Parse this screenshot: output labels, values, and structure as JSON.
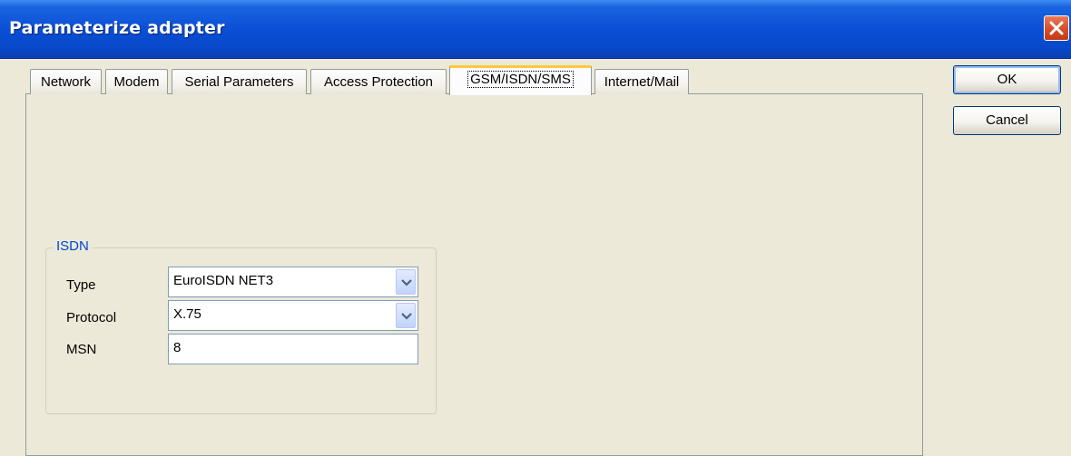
{
  "window": {
    "title": "Parameterize adapter"
  },
  "tabs": [
    {
      "label": "Network"
    },
    {
      "label": "Modem"
    },
    {
      "label": "Serial Parameters"
    },
    {
      "label": "Access Protection"
    },
    {
      "label": "GSM/ISDN/SMS"
    },
    {
      "label": "Internet/Mail"
    }
  ],
  "active_tab": "GSM/ISDN/SMS",
  "isdn": {
    "group_title": "ISDN",
    "type_label": "Type",
    "type_value": "EuroISDN NET3",
    "protocol_label": "Protocol",
    "protocol_value": "X.75",
    "msn_label": "MSN",
    "msn_value": "8"
  },
  "buttons": {
    "ok": "OK",
    "cancel": "Cancel"
  },
  "colors": {
    "titlebar": "#0a4fd6",
    "close_button": "#d8512e",
    "group_title": "#0046d5",
    "active_tab_highlight": "#ffc83c",
    "dialog_bg": "#ece9d8"
  }
}
